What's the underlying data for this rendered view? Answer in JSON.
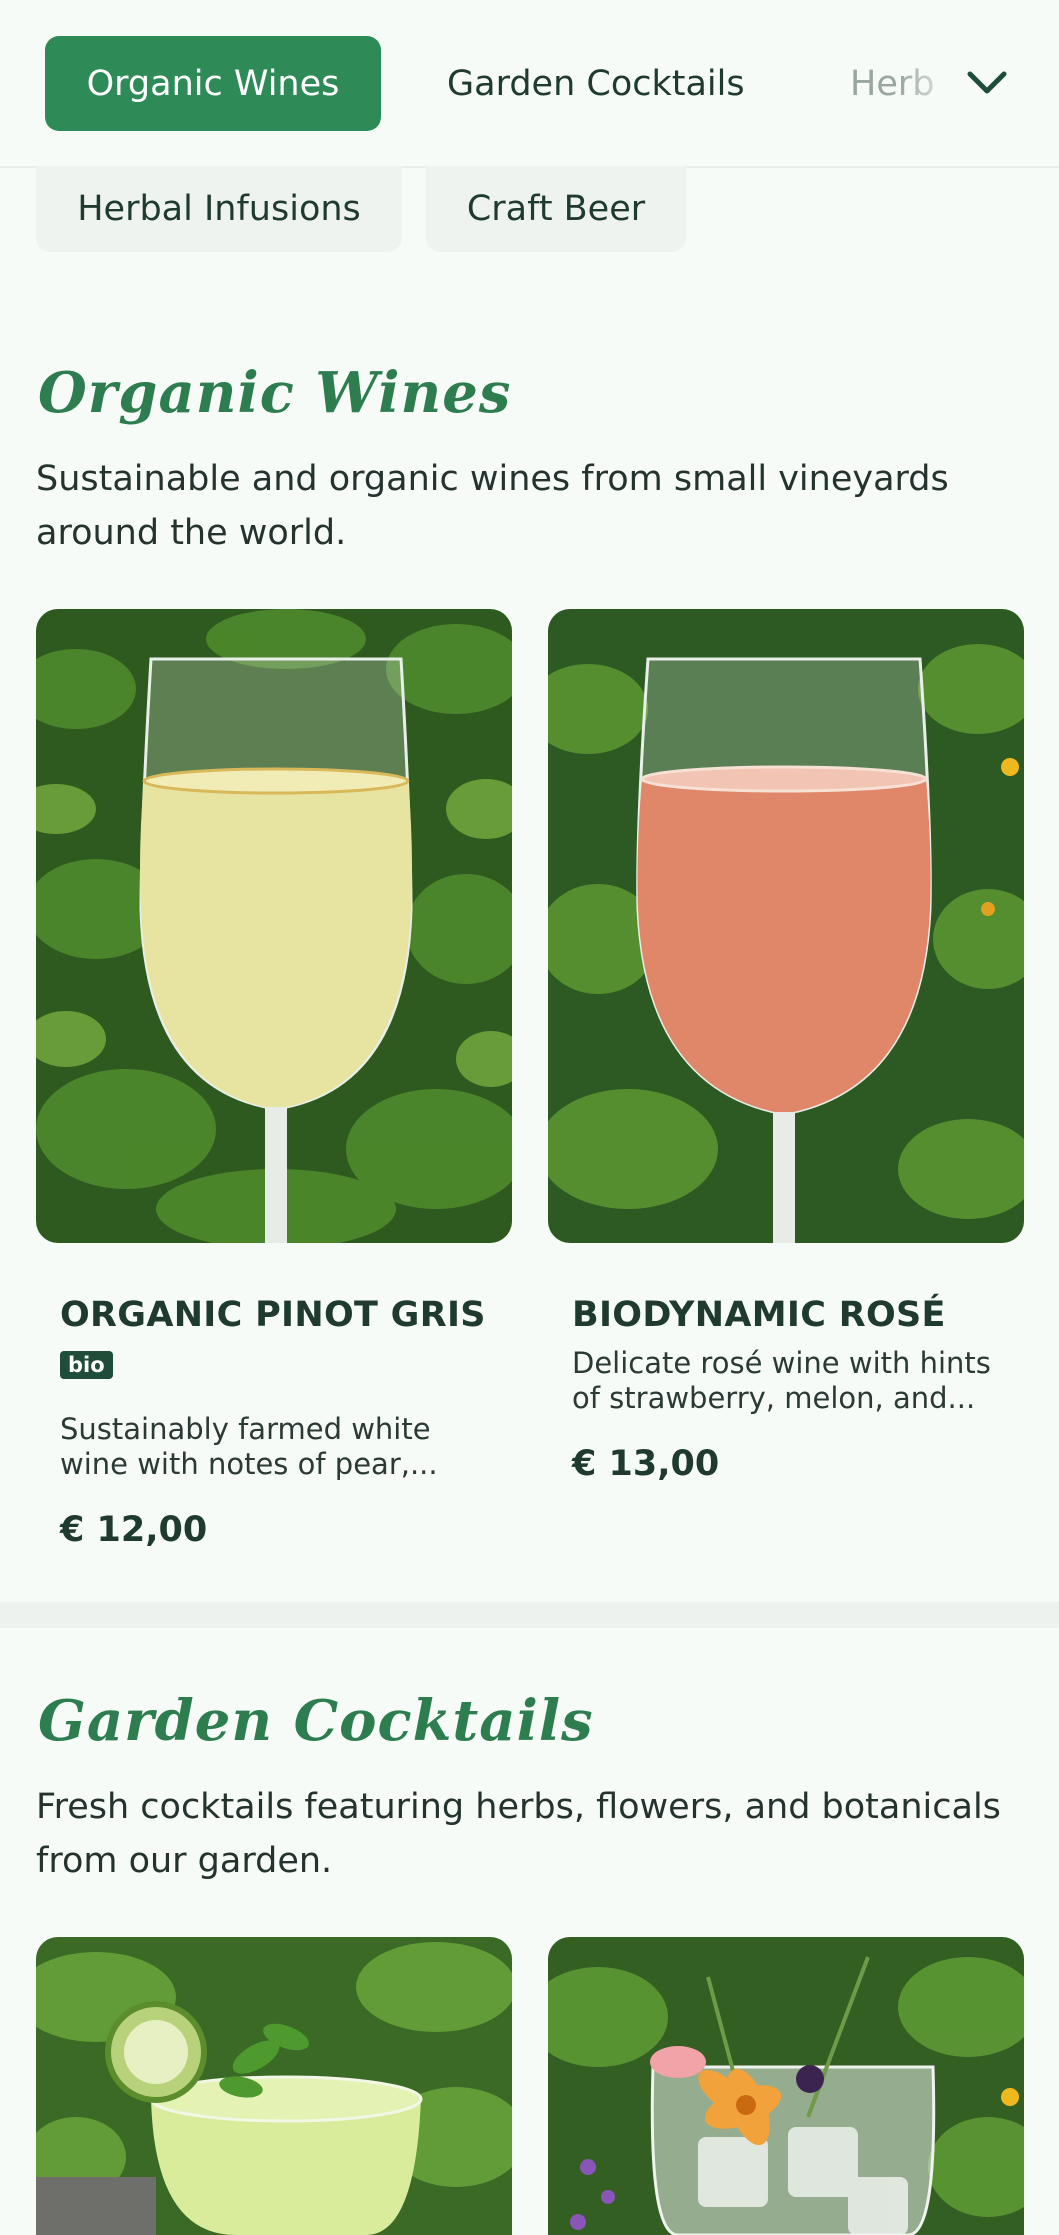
{
  "tabs": {
    "active": "Organic Wines",
    "second": "Garden Cocktails",
    "third_partial": "Herb"
  },
  "pills": [
    "Herbal Infusions",
    "Craft Beer"
  ],
  "sections": [
    {
      "title": "Organic Wines",
      "description": "Sustainable and organic wines from small vineyards around the world.",
      "items": [
        {
          "name": "ORGANIC PINOT GRIS",
          "badge": "bio",
          "description": "Sustainably farmed white wine with notes of pear,...",
          "price": "€ 12,00"
        },
        {
          "name": "BIODYNAMIC ROSÉ",
          "description": "Delicate rosé wine with hints of strawberry, melon, and...",
          "price": "€ 13,00"
        }
      ]
    },
    {
      "title": "Garden Cocktails",
      "description": "Fresh cocktails featuring herbs, flowers, and botanicals from our garden."
    }
  ],
  "colors": {
    "accent": "#2e8b57",
    "title": "#2e7d4f",
    "badge": "#1f4d39",
    "background": "#f6fbf7"
  },
  "icons": {
    "expand": "chevron-down-icon"
  }
}
